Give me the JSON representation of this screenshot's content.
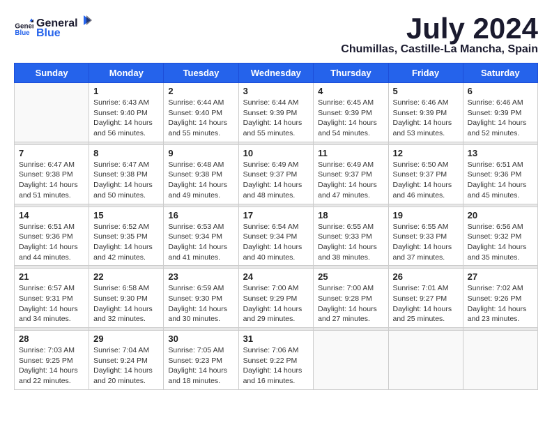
{
  "header": {
    "logo_line1": "General",
    "logo_line2": "Blue",
    "month_year": "July 2024",
    "location": "Chumillas, Castille-La Mancha, Spain"
  },
  "weekdays": [
    "Sunday",
    "Monday",
    "Tuesday",
    "Wednesday",
    "Thursday",
    "Friday",
    "Saturday"
  ],
  "weeks": [
    [
      {
        "day": "",
        "info": ""
      },
      {
        "day": "1",
        "info": "Sunrise: 6:43 AM\nSunset: 9:40 PM\nDaylight: 14 hours\nand 56 minutes."
      },
      {
        "day": "2",
        "info": "Sunrise: 6:44 AM\nSunset: 9:40 PM\nDaylight: 14 hours\nand 55 minutes."
      },
      {
        "day": "3",
        "info": "Sunrise: 6:44 AM\nSunset: 9:39 PM\nDaylight: 14 hours\nand 55 minutes."
      },
      {
        "day": "4",
        "info": "Sunrise: 6:45 AM\nSunset: 9:39 PM\nDaylight: 14 hours\nand 54 minutes."
      },
      {
        "day": "5",
        "info": "Sunrise: 6:46 AM\nSunset: 9:39 PM\nDaylight: 14 hours\nand 53 minutes."
      },
      {
        "day": "6",
        "info": "Sunrise: 6:46 AM\nSunset: 9:39 PM\nDaylight: 14 hours\nand 52 minutes."
      }
    ],
    [
      {
        "day": "7",
        "info": "Sunrise: 6:47 AM\nSunset: 9:38 PM\nDaylight: 14 hours\nand 51 minutes."
      },
      {
        "day": "8",
        "info": "Sunrise: 6:47 AM\nSunset: 9:38 PM\nDaylight: 14 hours\nand 50 minutes."
      },
      {
        "day": "9",
        "info": "Sunrise: 6:48 AM\nSunset: 9:38 PM\nDaylight: 14 hours\nand 49 minutes."
      },
      {
        "day": "10",
        "info": "Sunrise: 6:49 AM\nSunset: 9:37 PM\nDaylight: 14 hours\nand 48 minutes."
      },
      {
        "day": "11",
        "info": "Sunrise: 6:49 AM\nSunset: 9:37 PM\nDaylight: 14 hours\nand 47 minutes."
      },
      {
        "day": "12",
        "info": "Sunrise: 6:50 AM\nSunset: 9:37 PM\nDaylight: 14 hours\nand 46 minutes."
      },
      {
        "day": "13",
        "info": "Sunrise: 6:51 AM\nSunset: 9:36 PM\nDaylight: 14 hours\nand 45 minutes."
      }
    ],
    [
      {
        "day": "14",
        "info": "Sunrise: 6:51 AM\nSunset: 9:36 PM\nDaylight: 14 hours\nand 44 minutes."
      },
      {
        "day": "15",
        "info": "Sunrise: 6:52 AM\nSunset: 9:35 PM\nDaylight: 14 hours\nand 42 minutes."
      },
      {
        "day": "16",
        "info": "Sunrise: 6:53 AM\nSunset: 9:34 PM\nDaylight: 14 hours\nand 41 minutes."
      },
      {
        "day": "17",
        "info": "Sunrise: 6:54 AM\nSunset: 9:34 PM\nDaylight: 14 hours\nand 40 minutes."
      },
      {
        "day": "18",
        "info": "Sunrise: 6:55 AM\nSunset: 9:33 PM\nDaylight: 14 hours\nand 38 minutes."
      },
      {
        "day": "19",
        "info": "Sunrise: 6:55 AM\nSunset: 9:33 PM\nDaylight: 14 hours\nand 37 minutes."
      },
      {
        "day": "20",
        "info": "Sunrise: 6:56 AM\nSunset: 9:32 PM\nDaylight: 14 hours\nand 35 minutes."
      }
    ],
    [
      {
        "day": "21",
        "info": "Sunrise: 6:57 AM\nSunset: 9:31 PM\nDaylight: 14 hours\nand 34 minutes."
      },
      {
        "day": "22",
        "info": "Sunrise: 6:58 AM\nSunset: 9:30 PM\nDaylight: 14 hours\nand 32 minutes."
      },
      {
        "day": "23",
        "info": "Sunrise: 6:59 AM\nSunset: 9:30 PM\nDaylight: 14 hours\nand 30 minutes."
      },
      {
        "day": "24",
        "info": "Sunrise: 7:00 AM\nSunset: 9:29 PM\nDaylight: 14 hours\nand 29 minutes."
      },
      {
        "day": "25",
        "info": "Sunrise: 7:00 AM\nSunset: 9:28 PM\nDaylight: 14 hours\nand 27 minutes."
      },
      {
        "day": "26",
        "info": "Sunrise: 7:01 AM\nSunset: 9:27 PM\nDaylight: 14 hours\nand 25 minutes."
      },
      {
        "day": "27",
        "info": "Sunrise: 7:02 AM\nSunset: 9:26 PM\nDaylight: 14 hours\nand 23 minutes."
      }
    ],
    [
      {
        "day": "28",
        "info": "Sunrise: 7:03 AM\nSunset: 9:25 PM\nDaylight: 14 hours\nand 22 minutes."
      },
      {
        "day": "29",
        "info": "Sunrise: 7:04 AM\nSunset: 9:24 PM\nDaylight: 14 hours\nand 20 minutes."
      },
      {
        "day": "30",
        "info": "Sunrise: 7:05 AM\nSunset: 9:23 PM\nDaylight: 14 hours\nand 18 minutes."
      },
      {
        "day": "31",
        "info": "Sunrise: 7:06 AM\nSunset: 9:22 PM\nDaylight: 14 hours\nand 16 minutes."
      },
      {
        "day": "",
        "info": ""
      },
      {
        "day": "",
        "info": ""
      },
      {
        "day": "",
        "info": ""
      }
    ]
  ]
}
